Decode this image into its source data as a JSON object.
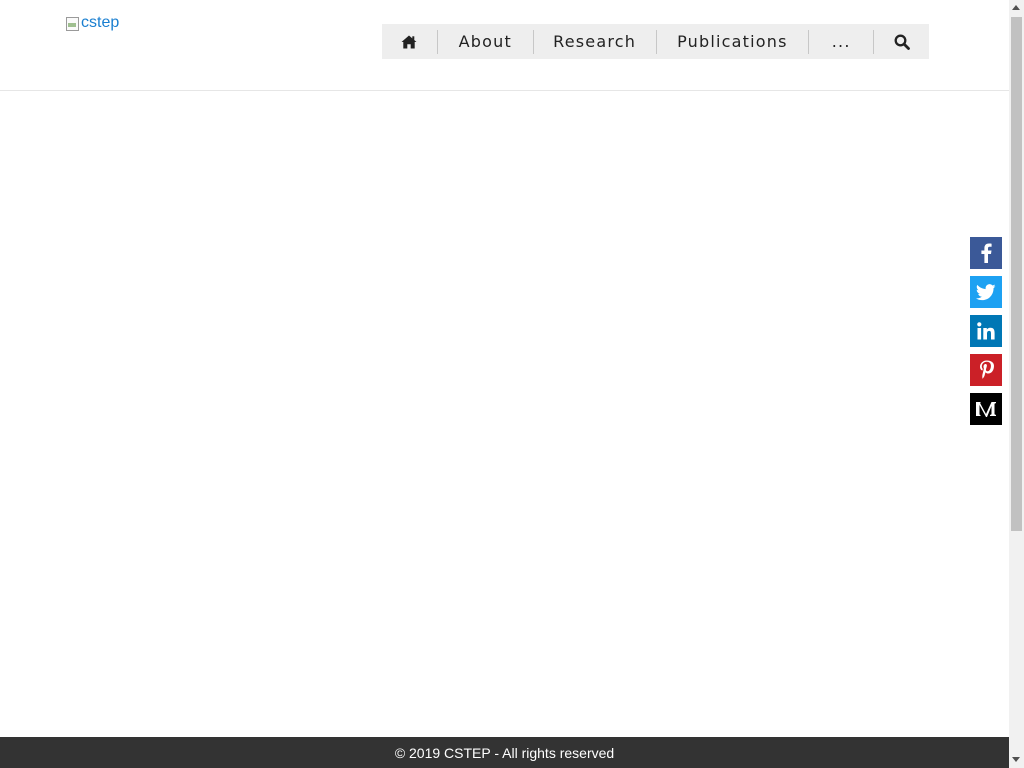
{
  "header": {
    "logo_alt": "cstep"
  },
  "nav": {
    "home_icon": "home-icon",
    "items": [
      {
        "label": "About"
      },
      {
        "label": "Research"
      },
      {
        "label": "Publications"
      },
      {
        "label": "..."
      }
    ],
    "search_icon": "search-icon",
    "bar_color": "#eeeeee"
  },
  "social": {
    "buttons": [
      {
        "icon": "facebook-icon",
        "color": "#3b5998"
      },
      {
        "icon": "twitter-icon",
        "color": "#1da1f2"
      },
      {
        "icon": "linkedin-icon",
        "color": "#0077b5"
      },
      {
        "icon": "pinterest-icon",
        "color": "#cb2027"
      },
      {
        "icon": "medium-icon",
        "color": "#000000"
      }
    ]
  },
  "footer": {
    "text": "© 2019 CSTEP - All rights reserved",
    "background": "#333333"
  }
}
